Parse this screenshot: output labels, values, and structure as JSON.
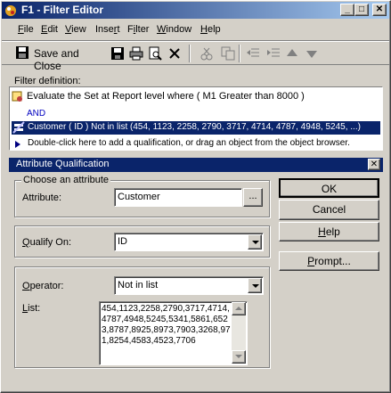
{
  "window": {
    "title": "F1 - Filter Editor"
  },
  "menu": [
    "File",
    "Edit",
    "View",
    "Insert",
    "Filter",
    "Window",
    "Help"
  ],
  "toolbar": {
    "save_close_label": "Save and Close"
  },
  "filter_definition": {
    "label": "Filter definition:",
    "lines": [
      "Evaluate the Set at Report level  where ( M1 Greater than 8000 )",
      "AND",
      "Customer ( ID )  Not in list (454, 1123, 2258, 2790, 3717, 4714, 4787, 4948, 5245, ...)",
      "Double-click here to add a qualification, or drag an object from the object browser."
    ]
  },
  "attribute_qualification": {
    "title": "Attribute Qualification",
    "choose_group": "Choose an attribute",
    "attribute_label": "Attribute:",
    "attribute_value": "Customer",
    "browse_label": "...",
    "qualify_label": "Qualify On:",
    "qualify_value": "ID",
    "operator_label": "Operator:",
    "operator_value": "Not in list",
    "list_label": "List:",
    "list_value": "454,1123,2258,2790,3717,4714,4787,4948,5245,5341,5861,6523,8787,8925,8973,7903,3268,971,8254,4583,4523,7706",
    "buttons": {
      "ok": "OK",
      "cancel": "Cancel",
      "help": "Help",
      "prompt": "Prompt..."
    }
  }
}
